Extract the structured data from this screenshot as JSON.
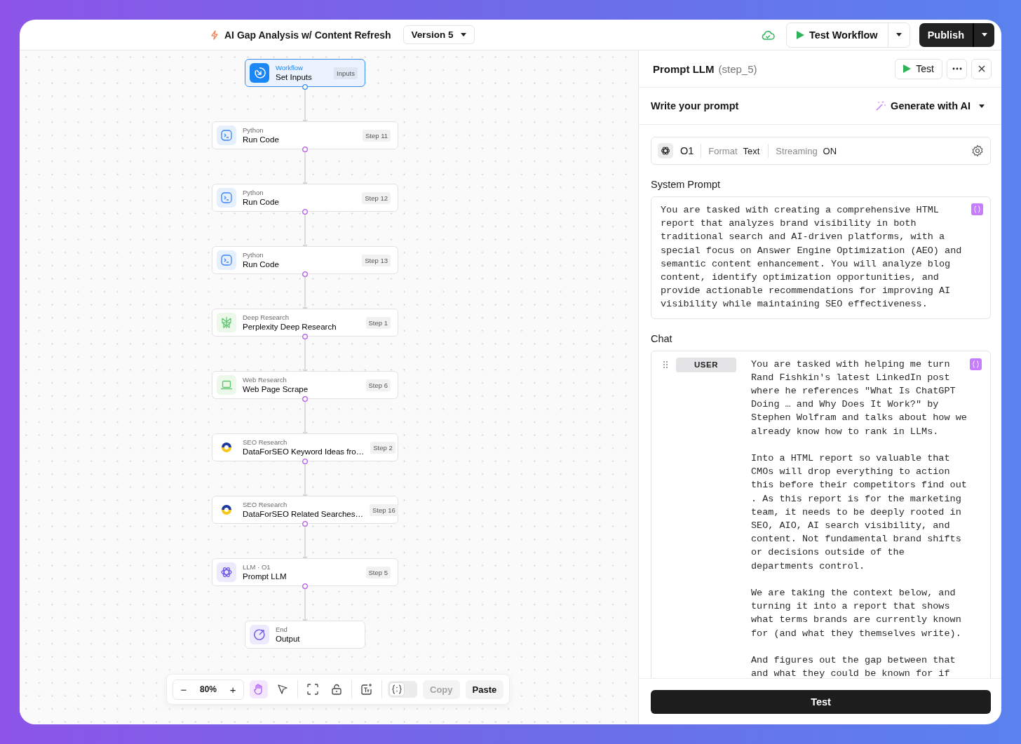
{
  "header": {
    "title": "AI Gap Analysis w/ Content Refresh",
    "version": "Version 5",
    "test_button": "Test Workflow",
    "publish_button": "Publish"
  },
  "nodes": [
    {
      "kind": "workflow",
      "category": "Workflow",
      "title": "Set Inputs",
      "badge": "Inputs",
      "selected": true
    },
    {
      "kind": "python",
      "category": "Python",
      "title": "Run Code",
      "badge": "Step 11",
      "selected": false
    },
    {
      "kind": "python",
      "category": "Python",
      "title": "Run Code",
      "badge": "Step 12",
      "selected": false
    },
    {
      "kind": "python",
      "category": "Python",
      "title": "Run Code",
      "badge": "Step 13",
      "selected": false
    },
    {
      "kind": "perplexity",
      "category": "Deep Research",
      "title": "Perplexity Deep Research",
      "badge": "Step 1",
      "selected": false
    },
    {
      "kind": "web",
      "category": "Web Research",
      "title": "Web Page Scrape",
      "badge": "Step 6",
      "selected": false
    },
    {
      "kind": "seo",
      "category": "SEO Research",
      "title": "DataForSEO Keyword Ideas fro…",
      "badge": "Step 2",
      "selected": false
    },
    {
      "kind": "seo",
      "category": "SEO Research",
      "title": "DataForSEO Related Searches…",
      "badge": "Step 16",
      "selected": false
    },
    {
      "kind": "llm",
      "category": "LLM · O1",
      "title": "Prompt LLM",
      "badge": "Step 5",
      "selected": false
    },
    {
      "kind": "end",
      "category": "End",
      "title": "Output",
      "selected": false
    }
  ],
  "toolbar": {
    "zoom": "80%",
    "zoom_out": "−",
    "zoom_in": "+",
    "tools": [
      {
        "kind": "hand",
        "selected": true
      },
      {
        "kind": "pointer",
        "selected": false
      }
    ],
    "code_toggle": {
      "on": false
    },
    "copy": {
      "label": "Copy",
      "disabled": true
    },
    "paste": {
      "label": "Paste",
      "disabled": false
    }
  },
  "panel": {
    "title": "Prompt LLM",
    "step": "(step_5)",
    "test_button": "Test",
    "section_title": "Write your prompt",
    "generate_button": "Generate with AI",
    "model": {
      "name": "O1",
      "format_label": "Format",
      "format_value": "Text",
      "streaming_label": "Streaming",
      "streaming_value": "ON"
    },
    "system_prompt_label": "System Prompt",
    "system_prompt": "You are tasked with creating a comprehensive HTML report that analyzes brand visibility in both traditional search and AI-driven platforms, with a special focus on Answer Engine Optimization (AEO) and semantic content enhancement. You will analyze blog content, identify optimization opportunities, and provide actionable recommendations for improving AI visibility while maintaining SEO effectiveness.",
    "chat_label": "Chat",
    "messages": [
      {
        "role": "USER",
        "paragraphs": [
          "You are tasked with helping me turn Rand Fishkin's latest LinkedIn post where he references \"What Is ChatGPT Doing … and Why Does It Work?\" by Stephen Wolfram and talks about how we already know how to rank in LLMs.",
          "Into a HTML report so valuable that CMOs will drop everything to action this before their competitors find out . As this report is for the marketing team, it needs to be deeply rooted in SEO, AIO, AI search visibility, and content. Not fundamental brand shifts or decisions outside of the departments control.",
          "We are taking the context below, and turning it into a report that shows what terms brands are currently known for (and what they themselves write).",
          "And figures out the gap between that and what they could be known for if"
        ]
      }
    ],
    "footer_button": "Test"
  }
}
